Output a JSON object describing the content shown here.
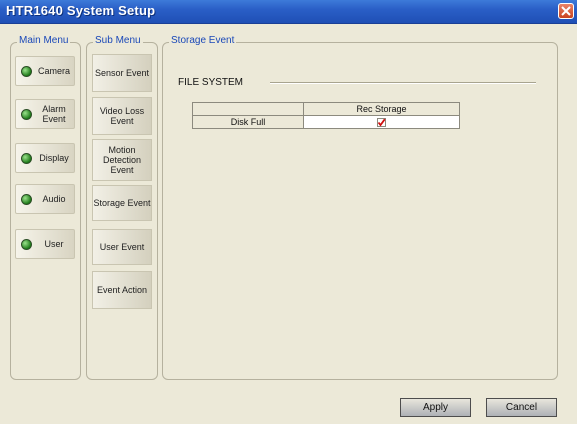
{
  "window": {
    "title": "HTR1640 System Setup"
  },
  "main_menu": {
    "label": "Main Menu",
    "items": [
      {
        "label": "Camera"
      },
      {
        "label": "Alarm\nEvent"
      },
      {
        "label": "Display"
      },
      {
        "label": "Audio"
      },
      {
        "label": "User"
      }
    ]
  },
  "sub_menu": {
    "label": "Sub Menu",
    "items": [
      {
        "label": "Sensor Event"
      },
      {
        "label": "Video Loss\nEvent"
      },
      {
        "label": "Motion\nDetection\nEvent"
      },
      {
        "label": "Storage Event"
      },
      {
        "label": "User Event"
      },
      {
        "label": "Event Action"
      }
    ]
  },
  "storage_event": {
    "label": "Storage Event",
    "section": "FILE SYSTEM",
    "table": {
      "column": "Rec Storage",
      "row": "Disk Full",
      "checked": true
    }
  },
  "buttons": {
    "apply": "Apply",
    "cancel": "Cancel"
  },
  "colors": {
    "title_bar": "#2a5fc7",
    "led": "#1e7b18",
    "check": "#d01010",
    "label_blue": "#1a48b8"
  }
}
